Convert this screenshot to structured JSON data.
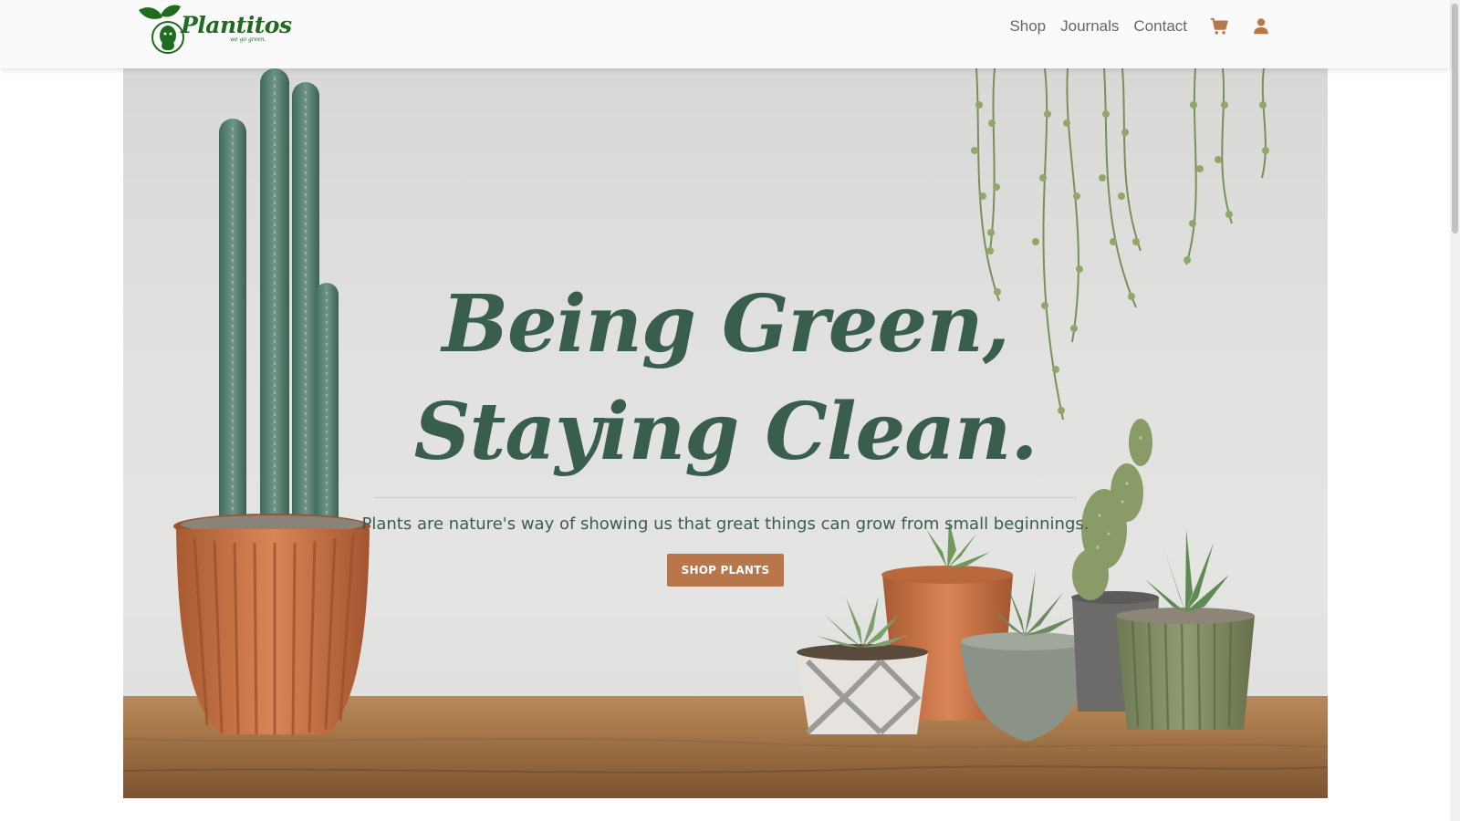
{
  "nav": {
    "brand_name": "Plantitos",
    "brand_tagline": "we go green.",
    "links": [
      "Shop",
      "Journals",
      "Contact"
    ],
    "cart_icon": "cart-icon",
    "user_icon": "user-icon",
    "link_color": "#666666",
    "icon_color": "#b8764a"
  },
  "hero": {
    "title_line1": "Being Green,",
    "title_line2": "Staying Clean.",
    "subtitle": "Plants are nature's way of showing us that great things can grow from small beginnings.",
    "cta_label": "SHOP PLANTS",
    "title_color": "#3a5e4d",
    "cta_color": "#b8764a"
  }
}
